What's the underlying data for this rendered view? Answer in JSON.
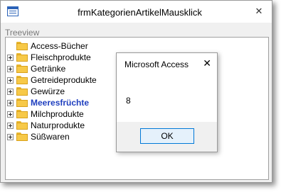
{
  "window": {
    "title": "frmKategorienArtikelMausklick",
    "close_glyph": "✕"
  },
  "treeview": {
    "label": "Treeview",
    "items": [
      {
        "label": "Access-Bücher",
        "expandable": false,
        "selected": false,
        "icon": "folder-icon"
      },
      {
        "label": "Fleischprodukte",
        "expandable": true,
        "selected": false,
        "icon": "folder-icon"
      },
      {
        "label": "Getränke",
        "expandable": true,
        "selected": false,
        "icon": "folder-icon"
      },
      {
        "label": "Getreideprodukte",
        "expandable": true,
        "selected": false,
        "icon": "folder-icon"
      },
      {
        "label": "Gewürze",
        "expandable": true,
        "selected": false,
        "icon": "folder-icon"
      },
      {
        "label": "Meeresfrüchte",
        "expandable": true,
        "selected": true,
        "icon": "folder-icon"
      },
      {
        "label": "Milchprodukte",
        "expandable": true,
        "selected": false,
        "icon": "folder-icon"
      },
      {
        "label": "Naturprodukte",
        "expandable": true,
        "selected": false,
        "icon": "folder-icon"
      },
      {
        "label": "Süßwaren",
        "expandable": true,
        "selected": false,
        "icon": "folder-icon"
      }
    ]
  },
  "dialog": {
    "title": "Microsoft Access",
    "close_glyph": "✕",
    "message": "8",
    "ok_label": "OK"
  },
  "colors": {
    "selected_text": "#1f3fbf",
    "folder_fill": "#f7c948",
    "ok_border": "#0078d7"
  }
}
